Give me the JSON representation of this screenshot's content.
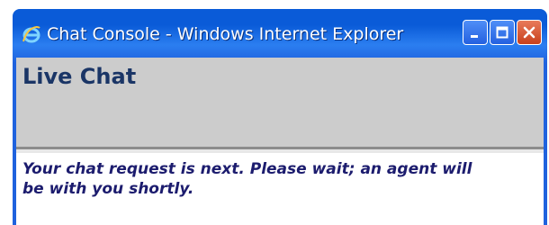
{
  "window": {
    "title": "Chat Console - Windows Internet Explorer",
    "icon": "internet-explorer-icon",
    "buttons": [
      "minimize-icon",
      "maximize-icon",
      "close-icon"
    ]
  },
  "header": {
    "title": "Live Chat"
  },
  "main": {
    "status_message": "Your chat request is next. Please wait; an agent will be with you shortly."
  },
  "colors": {
    "titlebar": "#0a5bd8",
    "header_panel": "#cccccc",
    "title_text": "#1a3566",
    "message_text": "#1c1c6e"
  }
}
